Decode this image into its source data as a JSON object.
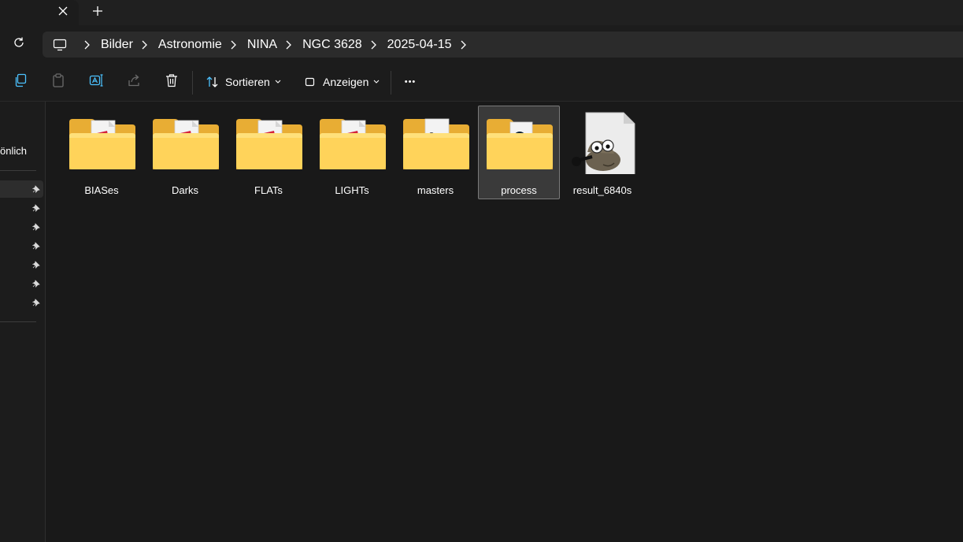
{
  "tabs": {
    "close_label": "×",
    "new_label": "+"
  },
  "breadcrumbs": [
    {
      "label": "Bilder"
    },
    {
      "label": "Astronomie"
    },
    {
      "label": "NINA"
    },
    {
      "label": "NGC 3628"
    },
    {
      "label": "2025-04-15"
    }
  ],
  "toolbar": {
    "sort_label": "Sortieren",
    "view_label": "Anzeigen",
    "more_label": "•••"
  },
  "sidebar": {
    "partial_label": "önlich",
    "pinned_count": 7
  },
  "items": [
    {
      "name": "BIASes",
      "type": "folder",
      "preview": "red-file"
    },
    {
      "name": "Darks",
      "type": "folder",
      "preview": "red-file"
    },
    {
      "name": "FLATs",
      "type": "folder",
      "preview": "red-file"
    },
    {
      "name": "LIGHTs",
      "type": "folder",
      "preview": "red-file"
    },
    {
      "name": "masters",
      "type": "folder",
      "preview": "gimp-file"
    },
    {
      "name": "process",
      "type": "folder",
      "preview": "astro-file",
      "selected": true
    },
    {
      "name": "result_6840s",
      "type": "file",
      "preview": "gimp-icon"
    }
  ],
  "colors": {
    "accent": "#4cc2ff",
    "folder_back": "#e8ad34",
    "folder_front": "#ffd35a",
    "background": "#191919"
  }
}
